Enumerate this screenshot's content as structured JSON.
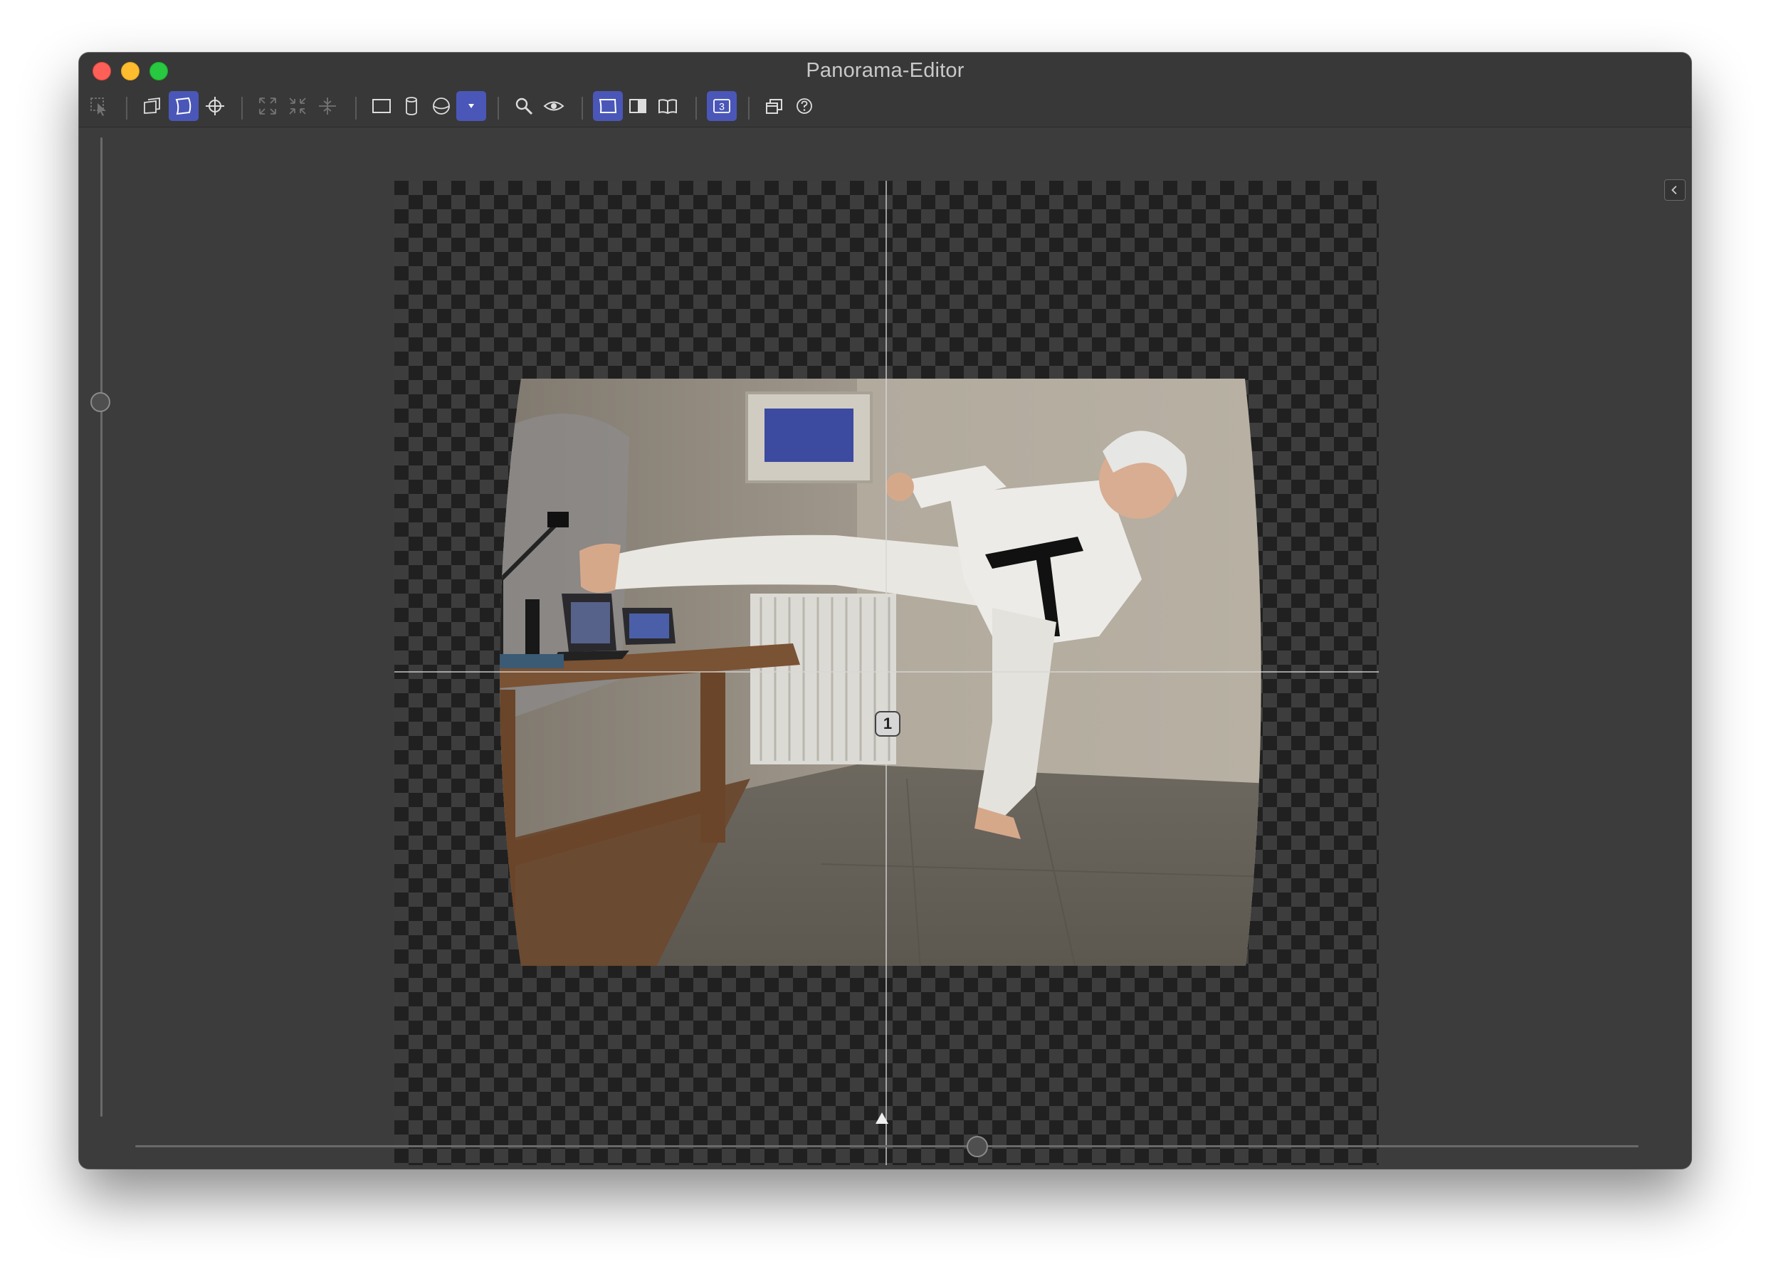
{
  "window": {
    "title": "Panorama-Editor"
  },
  "toolbar": {
    "tools": [
      {
        "name": "select-tool-icon",
        "state": "disabled"
      },
      {
        "name": "image-stack-icon",
        "state": "normal"
      },
      {
        "name": "warp-tool-icon",
        "state": "active"
      },
      {
        "name": "crosshair-icon",
        "state": "normal"
      },
      {
        "name": "expand-icon",
        "state": "disabled"
      },
      {
        "name": "collapse-icon",
        "state": "disabled"
      },
      {
        "name": "align-center-icon",
        "state": "disabled"
      },
      {
        "name": "rectilinear-projection-icon",
        "state": "normal"
      },
      {
        "name": "cylindrical-projection-icon",
        "state": "normal"
      },
      {
        "name": "spherical-projection-icon",
        "state": "normal"
      },
      {
        "name": "projection-dropdown-icon",
        "state": "active"
      },
      {
        "name": "zoom-icon",
        "state": "normal"
      },
      {
        "name": "preview-eye-icon",
        "state": "normal"
      },
      {
        "name": "single-page-view-icon",
        "state": "active"
      },
      {
        "name": "split-view-icon",
        "state": "normal"
      },
      {
        "name": "book-view-icon",
        "state": "normal"
      },
      {
        "name": "image-count-badge",
        "state": "active",
        "label": "3"
      },
      {
        "name": "layers-icon",
        "state": "normal"
      },
      {
        "name": "help-icon",
        "state": "normal"
      }
    ]
  },
  "canvas": {
    "center_marker_label": "1"
  },
  "sliders": {
    "vertical_value": 0.27,
    "horizontal_value": 0.56
  },
  "colors": {
    "accent": "#4a57b8",
    "window_bg": "#3c3c3c",
    "close": "#fe5f57",
    "minimize": "#febc2e",
    "maximize": "#28c840"
  }
}
